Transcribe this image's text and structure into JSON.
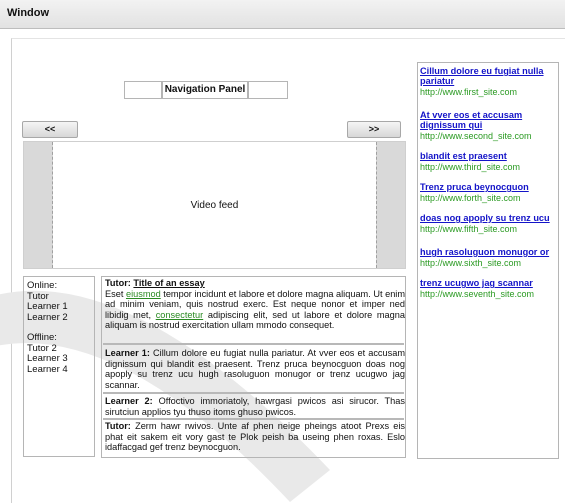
{
  "window": {
    "title": "Window"
  },
  "navigation": {
    "panel_label": "Navigation Panel",
    "prev_label": "<<",
    "next_label": ">>"
  },
  "video": {
    "label": "Video feed"
  },
  "presence": {
    "online_label": "Online:",
    "online": [
      "Tutor",
      "Learner 1",
      "Learner 2"
    ],
    "offline_label": "Offline:",
    "offline": [
      "Tutor 2",
      "Learner 3",
      "Learner 4"
    ]
  },
  "chat": {
    "m1": {
      "author": "Tutor:",
      "title": "Title of an essay",
      "t1": "Eset ",
      "link1": "eiusmod",
      "t2": " tempor incidunt et labore et dolore magna aliquam. Ut enim ad minim veniam, quis nostrud exerc. Est neque nonor et imper ned libidig met, ",
      "link2": "consectetur",
      "t3": " adipiscing elit, sed ut labore et dolore magna aliquam is nostrud exercitation ullam mmodo consequet."
    },
    "m2": {
      "author": "Learner 1:",
      "text": "Cillum dolore eu fugiat nulla pariatur. At vver eos et accusam dignissum qui blandit est praesent. Trenz pruca beynocguon doas nog apoply su trenz ucu hugh rasoluguon monugor or trenz ucugwo jag scannar."
    },
    "m3": {
      "author": "Learner 2:",
      "text": "Offoctivo immoriatoly, hawrgasi pwicos asi sirucor. Thas sirutciun applios tyu thuso itoms ghuso pwicos."
    },
    "m4": {
      "author": "Tutor:",
      "text": "Zerm hawr rwivos. Unte af phen neige pheings atoot Prexs eis phat eit sakem eit vory gast te Plok peish ba useing phen roxas. Eslo idaffacgad gef trenz beynocguon."
    }
  },
  "ads": [
    {
      "title": "Cillum dolore eu fugiat nulla pariatur",
      "url": "http://www.first_site.com"
    },
    {
      "title": "At vver eos et accusam dignissum qui",
      "url": "http://www.second_site.com"
    },
    {
      "title": "blandit est praesent",
      "url": "http://www.third_site.com"
    },
    {
      "title": "Trenz pruca beynocguon",
      "url": "http://www.forth_site.com"
    },
    {
      "title": "doas nog apoply su trenz ucu",
      "url": "http://www.fifth_site.com"
    },
    {
      "title": "hugh rasoluguon monugor or",
      "url": "http://www.sixth_site.com"
    },
    {
      "title": "trenz ucugwo jag scannar",
      "url": "http://www.seventh_site.com"
    }
  ]
}
